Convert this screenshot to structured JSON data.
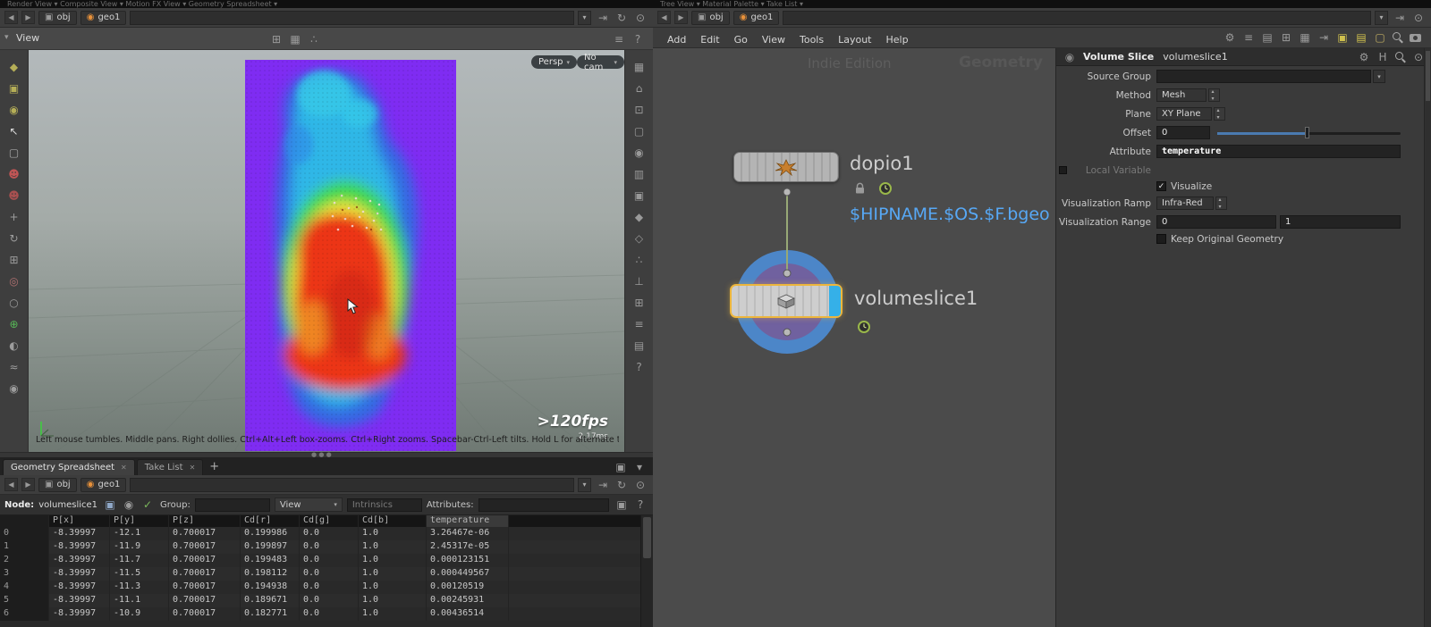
{
  "chrome": {
    "left_strip": "Render View ▾        Composite View ▾        Motion FX View ▾        Geometry Spreadsheet ▾",
    "right_strip": "Tree View ▾        Material Palette ▾        Take List ▾"
  },
  "colors": {
    "accent_blue": "#4d9be8",
    "selection_yellow": "#edb63c",
    "slice_purple": "#7f2cf2",
    "ring_blue": "#4c86c8",
    "ring_purple": "#70619f",
    "file_link_blue": "#57a8f5",
    "display_flag_cyan": "#35b0e8"
  },
  "left": {
    "pathbar": {
      "context": "obj",
      "node": "geo1"
    },
    "pathbar_icons": [
      {
        "name": "link-editor-icon",
        "glyph": "⇥"
      },
      {
        "name": "refresh-icon",
        "glyph": "↻"
      },
      {
        "name": "pin-pane-icon",
        "glyph": "⊙"
      }
    ],
    "view": {
      "title": "View",
      "header_center_icons": [
        {
          "name": "snap-grid-icon",
          "glyph": "⊞"
        },
        {
          "name": "snap-primitive-icon",
          "glyph": "▦"
        },
        {
          "name": "snap-point-icon",
          "glyph": "∴"
        }
      ],
      "header_right_icons": [
        {
          "name": "pane-menu-icon",
          "glyph": "≡"
        },
        {
          "name": "help-icon",
          "glyph": "?"
        }
      ]
    },
    "viewport": {
      "persp_label": "Persp",
      "cam_label": "No cam",
      "fps_label": ">120fps",
      "ms_label": "2.17ms",
      "help_text": "Left mouse tumbles. Middle pans. Right dollies. Ctrl+Alt+Left box-zooms. Ctrl+Right zooms. Spacebar-Ctrl-Left tilts. Hold L for alternate tumble, dolly, and zoom"
    },
    "left_toolbar": [
      {
        "name": "handles-tool-icon",
        "glyph": "◆",
        "color": "#b5ae57"
      },
      {
        "name": "place-object-tool-icon",
        "glyph": "▣",
        "color": "#b5ae57"
      },
      {
        "name": "draw-curve-tool-icon",
        "glyph": "◉",
        "color": "#b5ae57"
      },
      {
        "name": "select-tool-icon",
        "glyph": "↖",
        "color": "#dcdcdc"
      },
      {
        "name": "secure-selection-lock-icon",
        "glyph": "▢",
        "color": "#a8a8a8"
      },
      {
        "name": "pose-tool-icon",
        "glyph": "☻",
        "color": "#c05555"
      },
      {
        "name": "character-tool-icon",
        "glyph": "☻",
        "color": "#a85050"
      },
      {
        "name": "translate-tool-icon",
        "glyph": "+",
        "color": "#9c9c9c"
      },
      {
        "name": "rotate-tool-icon",
        "glyph": "↻",
        "color": "#9c9c9c"
      },
      {
        "name": "scale-tool-icon",
        "glyph": "⊞",
        "color": "#9c9c9c"
      },
      {
        "name": "rig-tool-icon",
        "glyph": "◎",
        "color": "#b07070"
      },
      {
        "name": "joint-tool-icon",
        "glyph": "○",
        "color": "#9c9c9c"
      },
      {
        "name": "paint-tool-icon",
        "glyph": "⊕",
        "color": "#57b857"
      },
      {
        "name": "sculpt-tool-icon",
        "glyph": "◐",
        "color": "#9c9c9c"
      },
      {
        "name": "comb-tool-icon",
        "glyph": "≈",
        "color": "#9c9c9c"
      },
      {
        "name": "visibility-tool-icon",
        "glyph": "◉",
        "color": "#9c9c9c"
      }
    ],
    "right_toolbar": [
      {
        "name": "viewport-layout-icon",
        "glyph": "▦"
      },
      {
        "name": "home-view-icon",
        "glyph": "⌂"
      },
      {
        "name": "frame-view-icon",
        "glyph": "⊡"
      },
      {
        "name": "view-lock-icon",
        "glyph": "▢"
      },
      {
        "name": "camera-view-icon",
        "glyph": "◉"
      },
      {
        "name": "flipbook-icon",
        "glyph": "▥"
      },
      {
        "name": "snapshot-icon",
        "glyph": "▣"
      },
      {
        "name": "display-shaded-icon",
        "glyph": "◆"
      },
      {
        "name": "display-wireframe-icon",
        "glyph": "◇"
      },
      {
        "name": "display-points-icon",
        "glyph": "∴"
      },
      {
        "name": "display-normals-icon",
        "glyph": "⊥"
      },
      {
        "name": "grid-toggle-icon",
        "glyph": "⊞"
      },
      {
        "name": "ruler-icon",
        "glyph": "≡"
      },
      {
        "name": "view-options-icon",
        "glyph": "▤"
      },
      {
        "name": "help-view-icon",
        "glyph": "?"
      }
    ],
    "spreadsheet": {
      "tabs": [
        {
          "label": "Geometry Spreadsheet"
        },
        {
          "label": "Take List"
        }
      ],
      "tabbar_icons": [
        {
          "name": "pane-layout-icon",
          "glyph": "▣"
        },
        {
          "name": "pane-dropdown-icon",
          "glyph": "▾"
        }
      ],
      "pathbar": {
        "context": "obj",
        "node": "geo1"
      },
      "controls": {
        "node_label": "Node:",
        "node_value": "volumeslice1",
        "group_label": "Group:",
        "view_dropdown": "View",
        "intrinsics_placeholder": "Intrinsics",
        "attributes_label": "Attributes:"
      },
      "control_icons": [
        {
          "name": "show-preview-icon",
          "glyph": "▣",
          "color": "#8fa8c8"
        },
        {
          "name": "pin-node-icon",
          "glyph": "◉",
          "color": "#9a9a9a"
        },
        {
          "name": "follow-selection-icon",
          "glyph": "✓",
          "color": "#7cb85c"
        }
      ],
      "right_icons": [
        {
          "name": "copy-table-icon",
          "glyph": "▣"
        },
        {
          "name": "help-icon",
          "glyph": "?"
        }
      ],
      "table": {
        "columns": [
          "",
          "P[x]",
          "P[y]",
          "P[z]",
          "Cd[r]",
          "Cd[g]",
          "Cd[b]",
          "temperature"
        ],
        "rows": [
          [
            "0",
            "-8.39997",
            "-12.1",
            "0.700017",
            "0.199986",
            "0.0",
            "1.0",
            "3.26467e-06"
          ],
          [
            "1",
            "-8.39997",
            "-11.9",
            "0.700017",
            "0.199897",
            "0.0",
            "1.0",
            "2.45317e-05"
          ],
          [
            "2",
            "-8.39997",
            "-11.7",
            "0.700017",
            "0.199483",
            "0.0",
            "1.0",
            "0.000123151"
          ],
          [
            "3",
            "-8.39997",
            "-11.5",
            "0.700017",
            "0.198112",
            "0.0",
            "1.0",
            "0.000449567"
          ],
          [
            "4",
            "-8.39997",
            "-11.3",
            "0.700017",
            "0.194938",
            "0.0",
            "1.0",
            "0.00120519"
          ],
          [
            "5",
            "-8.39997",
            "-11.1",
            "0.700017",
            "0.189671",
            "0.0",
            "1.0",
            "0.00245931"
          ],
          [
            "6",
            "-8.39997",
            "-10.9",
            "0.700017",
            "0.182771",
            "0.0",
            "1.0",
            "0.00436514"
          ]
        ]
      }
    }
  },
  "network": {
    "pathbar": {
      "context": "obj",
      "node": "geo1"
    },
    "pathbar_icons": [
      {
        "name": "link-editor-icon",
        "glyph": "⇥"
      },
      {
        "name": "pin-pane-icon",
        "glyph": "⊙"
      }
    ],
    "menus": [
      "Add",
      "Edit",
      "Go",
      "View",
      "Tools",
      "Layout",
      "Help"
    ],
    "toolbar_icons": [
      {
        "name": "tools-icon",
        "glyph": "⚙"
      },
      {
        "name": "align-nodes-icon",
        "glyph": "≡"
      },
      {
        "name": "parameters-pane-icon",
        "glyph": "▤"
      },
      {
        "name": "grid-display-icon",
        "glyph": "⊞"
      },
      {
        "name": "list-display-icon",
        "glyph": "▦"
      },
      {
        "name": "export-pane-icon",
        "glyph": "⇥"
      },
      {
        "name": "color-swatch-icon",
        "glyph": "▣",
        "color": "#cfc04e"
      },
      {
        "name": "sticky-note-icon",
        "glyph": "▤",
        "color": "#cfc04e"
      },
      {
        "name": "network-box-icon",
        "glyph": "▢",
        "color": "#c0ad62"
      },
      {
        "name": "search-icon",
        "shape": "search"
      },
      {
        "name": "snapshot-camera-icon",
        "shape": "camera"
      }
    ],
    "watermark_edition": "Indie Edition",
    "watermark_context": "Geometry",
    "nodes": {
      "upper": {
        "name": "dopio1"
      },
      "lower": {
        "name": "volumeslice1"
      }
    },
    "file_label": "$HIPNAME.$OS.$F.bgeo"
  },
  "params": {
    "title": "Volume Slice",
    "node_name": "volumeslice1",
    "header_icons": [
      {
        "name": "gear-menu-icon",
        "glyph": "⚙"
      },
      {
        "name": "houdini-logo-icon",
        "glyph": "H"
      },
      {
        "name": "search-icon",
        "shape": "search"
      },
      {
        "name": "pin-params-icon",
        "glyph": "⊙"
      }
    ],
    "source_group_label": "Source Group",
    "method_label": "Method",
    "method_value": "Mesh",
    "plane_label": "Plane",
    "plane_value": "XY Plane",
    "offset_label": "Offset",
    "offset_value": "0",
    "offset_fraction": 0.49,
    "attribute_label": "Attribute",
    "attribute_value": "temperature",
    "local_variable_label": "Local Variable",
    "visualize_label": "Visualize",
    "visualize_checked": true,
    "ramp_label": "Visualization Ramp",
    "ramp_value": "Infra-Red",
    "range_label": "Visualization Range",
    "range_min": "0",
    "range_max": "1",
    "keep_label": "Keep Original Geometry",
    "keep_checked": false
  }
}
